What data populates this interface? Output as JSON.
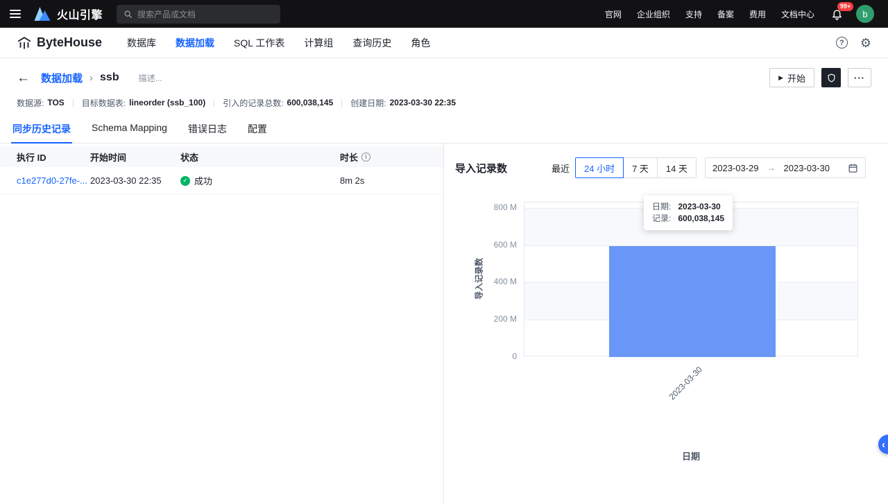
{
  "topbar": {
    "brand": "火山引擎",
    "search_placeholder": "搜索产品或文档",
    "links": [
      "官网",
      "企业组织",
      "支持",
      "备案",
      "费用",
      "文档中心"
    ],
    "notification_badge": "99+",
    "avatar_initial": "b"
  },
  "app_header": {
    "brand": "ByteHouse",
    "nav": [
      {
        "label": "数据库"
      },
      {
        "label": "数据加载",
        "active": true
      },
      {
        "label": "SQL 工作表"
      },
      {
        "label": "计算组"
      },
      {
        "label": "查询历史"
      },
      {
        "label": "角色"
      }
    ]
  },
  "page": {
    "breadcrumb_parent": "数据加载",
    "title": "ssb",
    "description_placeholder": "描述...",
    "start_button": "开始",
    "meta": [
      {
        "label": "数据源:",
        "value": "TOS"
      },
      {
        "label": "目标数据表:",
        "value": "lineorder (ssb_100)"
      },
      {
        "label": "引入的记录总数:",
        "value": "600,038,145"
      },
      {
        "label": "创建日期:",
        "value": "2023-03-30 22:35"
      }
    ]
  },
  "tabs": [
    {
      "label": "同步历史记录",
      "active": true
    },
    {
      "label": "Schema Mapping"
    },
    {
      "label": "错误日志"
    },
    {
      "label": "配置"
    }
  ],
  "history_table": {
    "columns": [
      "执行 ID",
      "开始时间",
      "状态",
      "时长"
    ],
    "rows": [
      {
        "execution_id": "c1e277d0-27fe-...",
        "start_time": "2023-03-30 22:35",
        "status": "成功",
        "duration": "8m 2s"
      }
    ]
  },
  "chart_panel": {
    "title": "导入记录数",
    "range_label": "最近",
    "range_options": [
      {
        "label": "24 小时",
        "active": true
      },
      {
        "label": "7 天"
      },
      {
        "label": "14 天"
      }
    ],
    "date_from": "2023-03-29",
    "date_to": "2023-03-30",
    "tooltip": {
      "date_label": "日期:",
      "date_value": "2023-03-30",
      "records_label": "记录:",
      "records_value": "600,038,145"
    }
  },
  "chart_data": {
    "type": "bar",
    "title": "导入记录数",
    "categories": [
      "2023-03-30"
    ],
    "values": [
      600038145
    ],
    "xlabel": "日期",
    "ylabel": "导入记录数",
    "ylim": [
      0,
      800000000
    ],
    "ytick_labels": [
      "800 M",
      "600 M",
      "400 M",
      "200 M",
      "0"
    ],
    "grid": true,
    "legend": "none"
  },
  "glyphs": {
    "back_arrow": "←",
    "breadcrumb_separator": "›",
    "play": "▶",
    "ellipsis": "···",
    "check": "✓",
    "arrow_right": "→",
    "question_mark": "?",
    "gear": "⚙",
    "info": "i",
    "chevron_left": "‹"
  },
  "colors": {
    "accent": "#1664ff",
    "bar": "#6996f7",
    "success": "#00b365",
    "topbar_bg": "#121214"
  }
}
